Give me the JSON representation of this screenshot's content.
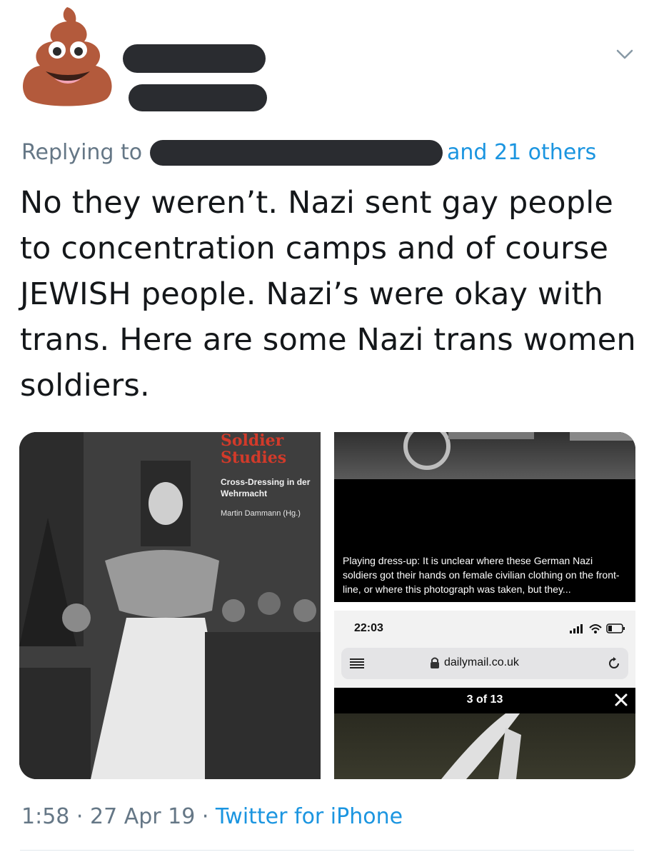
{
  "reply": {
    "prefix": "Replying to",
    "others": "and 21 others"
  },
  "tweet": {
    "text": "No they weren’t. Nazi sent gay people to concentration camps and of course JEWISH people. Nazi’s were okay with trans. Here are some Nazi trans women soldiers."
  },
  "media": {
    "book": {
      "title_line1": "Soldier",
      "title_line2": "Studies",
      "subtitle": "Cross-Dressing in der Wehrmacht",
      "author": "Martin Dammann (Hg.)"
    },
    "article": {
      "caption": "Playing dress-up: It is unclear where these German Nazi soldiers got their hands on female civilian clothing on the front-line, or where this photograph was taken, but they..."
    },
    "phone": {
      "time": "22:03",
      "url": "dailymail.co.uk",
      "gallery_count": "3 of 13"
    }
  },
  "footer": {
    "time": "1:58",
    "sep1": " · ",
    "date": "27 Apr 19",
    "sep2": " · ",
    "source": "Twitter for iPhone"
  },
  "colors": {
    "link": "#1b95e0",
    "muted": "#657786",
    "text": "#14171a",
    "redaction": "#2a2c30"
  },
  "icons": [
    "poo-emoji-avatar",
    "chevron-down-icon",
    "menu-icon",
    "lock-icon",
    "reload-icon",
    "close-icon",
    "signal-icon",
    "wifi-icon",
    "battery-icon"
  ]
}
